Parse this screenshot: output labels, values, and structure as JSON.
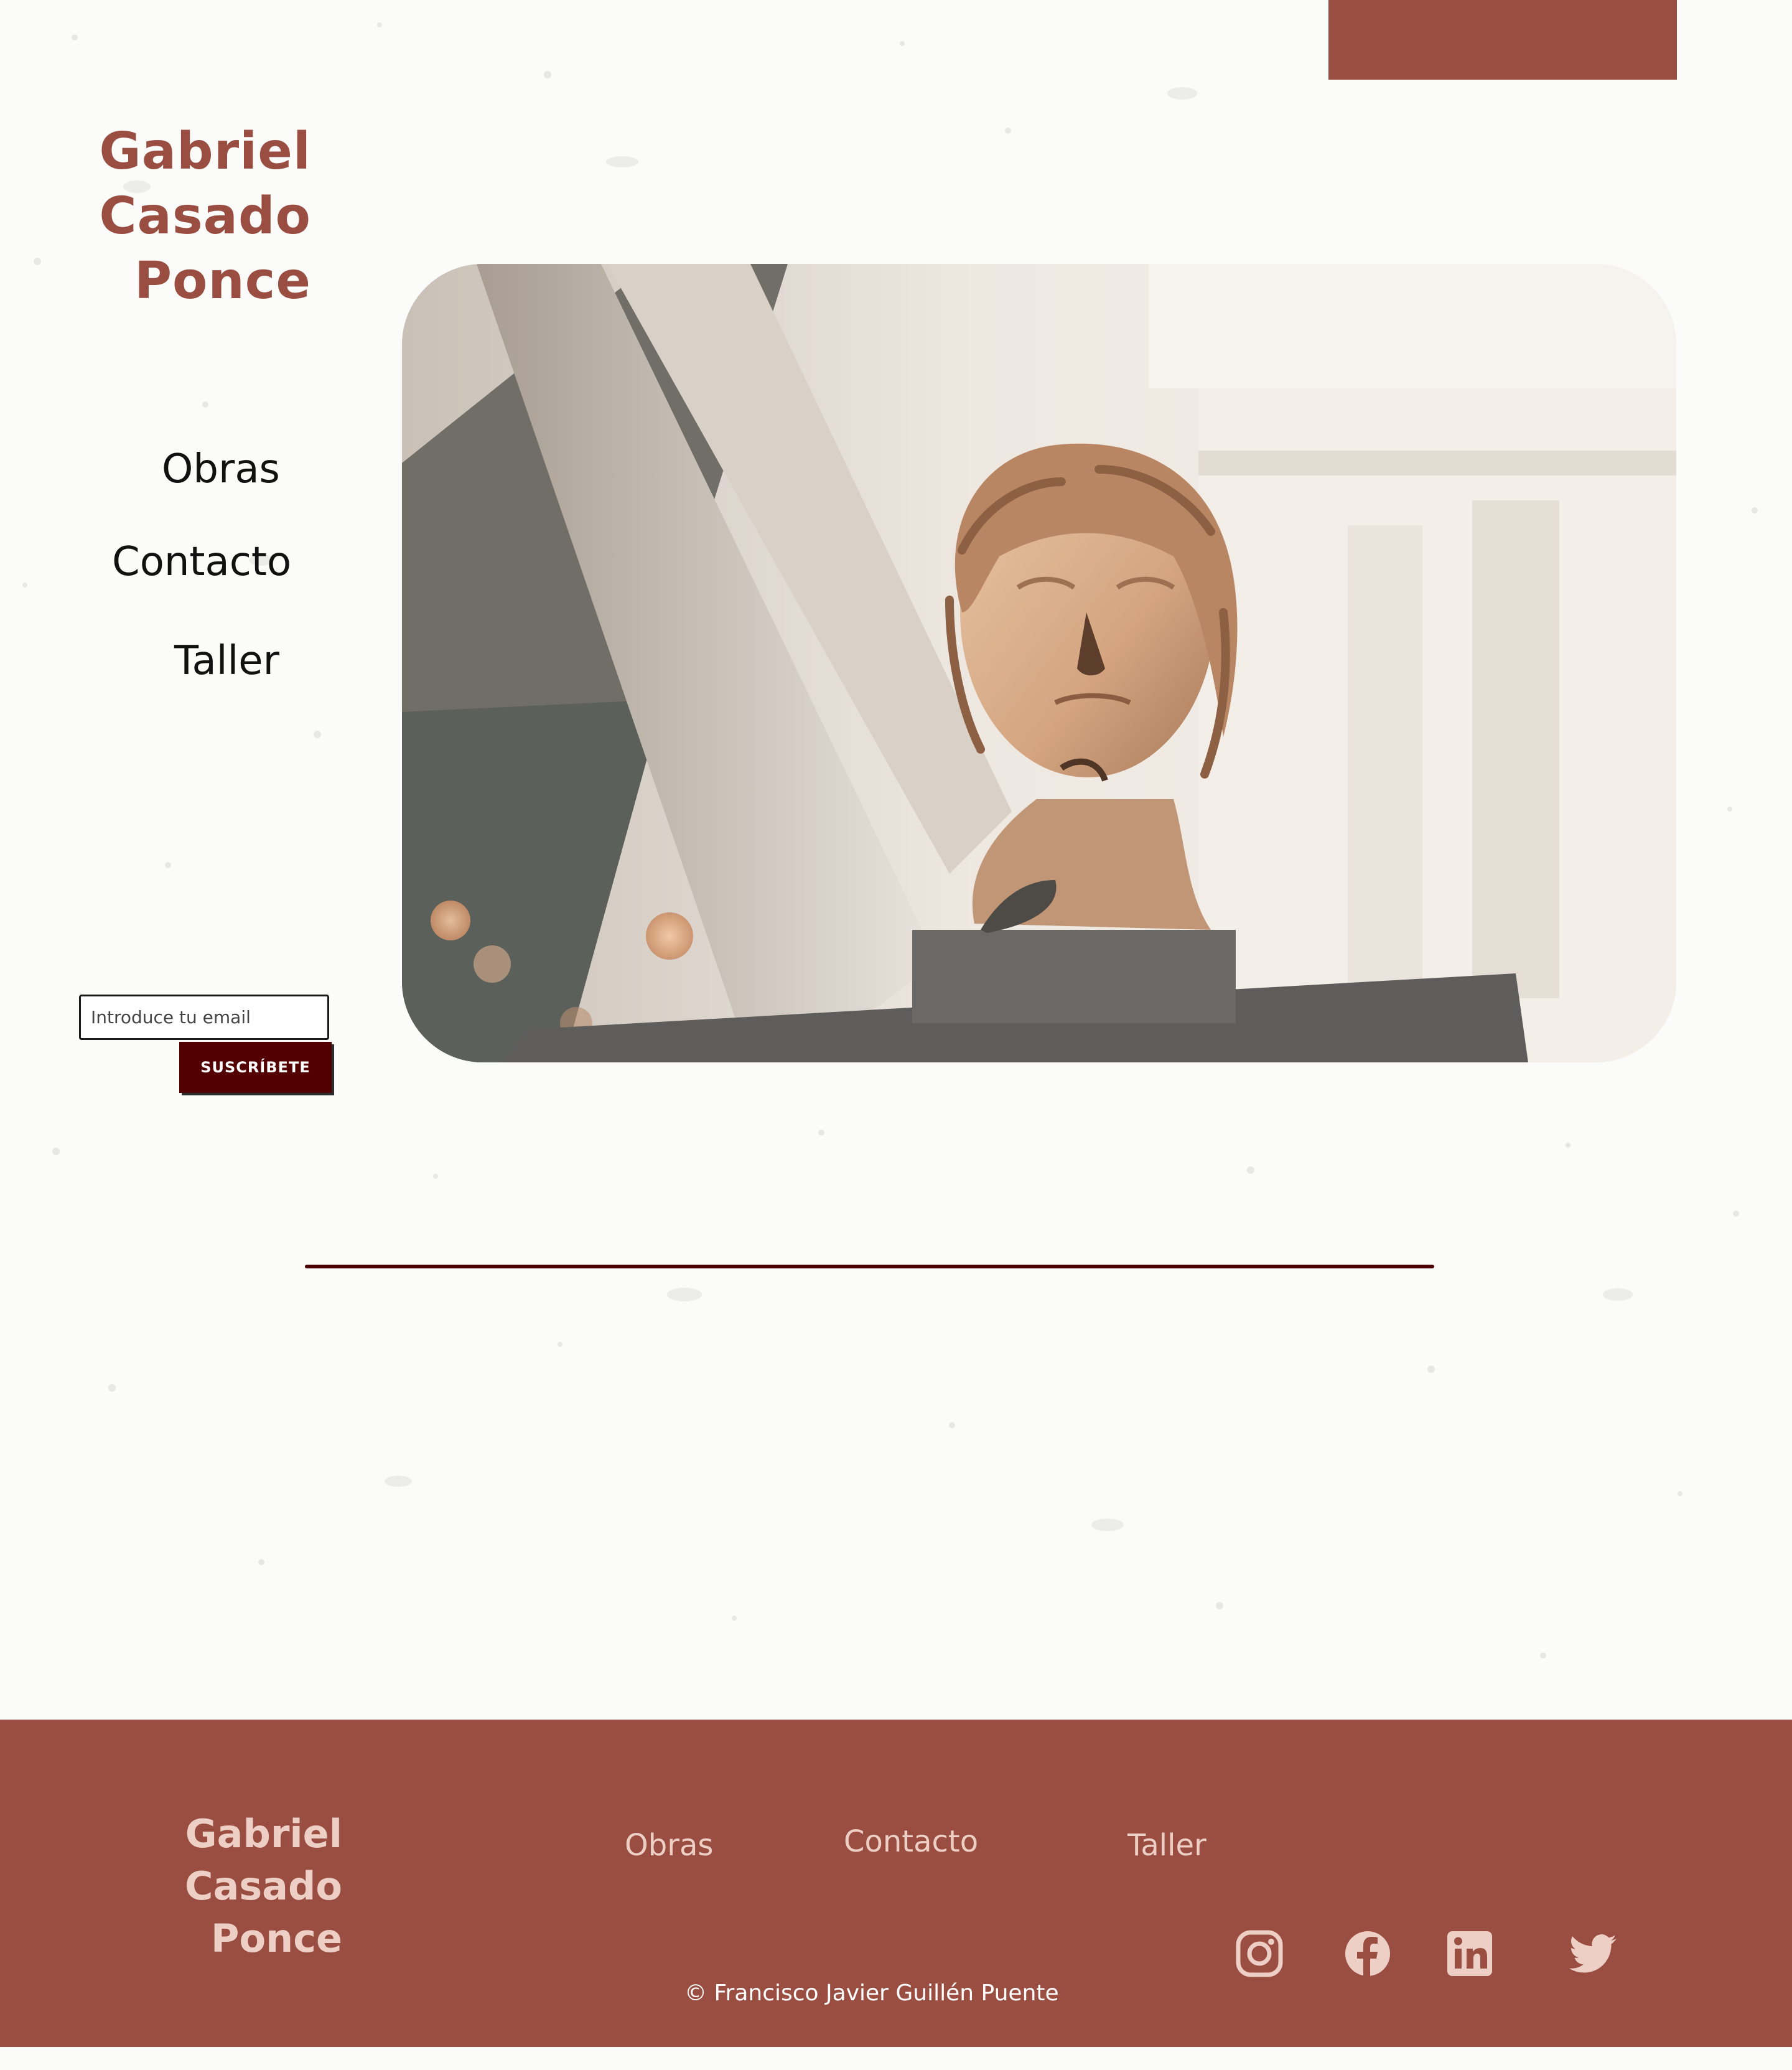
{
  "brand": {
    "line1": "Gabriel",
    "line2": "Casado",
    "line3": "Ponce"
  },
  "nav": [
    {
      "label": "Obras"
    },
    {
      "label": "Contacto"
    },
    {
      "label": "Taller"
    }
  ],
  "subscribe": {
    "placeholder": "Introduce tu email",
    "button_label": "SUSCRÍBETE"
  },
  "hero": {
    "image": "marble-bust-photo"
  },
  "footer": {
    "brand": {
      "line1": "Gabriel",
      "line2": "Casado",
      "line3": "Ponce"
    },
    "nav": [
      {
        "label": "Obras"
      },
      {
        "label": "Contacto"
      },
      {
        "label": "Taller"
      }
    ],
    "copyright": "© Francisco Javier Guillén Puente",
    "social": [
      "instagram-icon",
      "facebook-icon",
      "linkedin-icon",
      "twitter-icon"
    ]
  },
  "colors": {
    "accent": "#9a4e41",
    "button": "#520002",
    "rule": "#4a0003",
    "footer_text": "#edcfc6"
  }
}
